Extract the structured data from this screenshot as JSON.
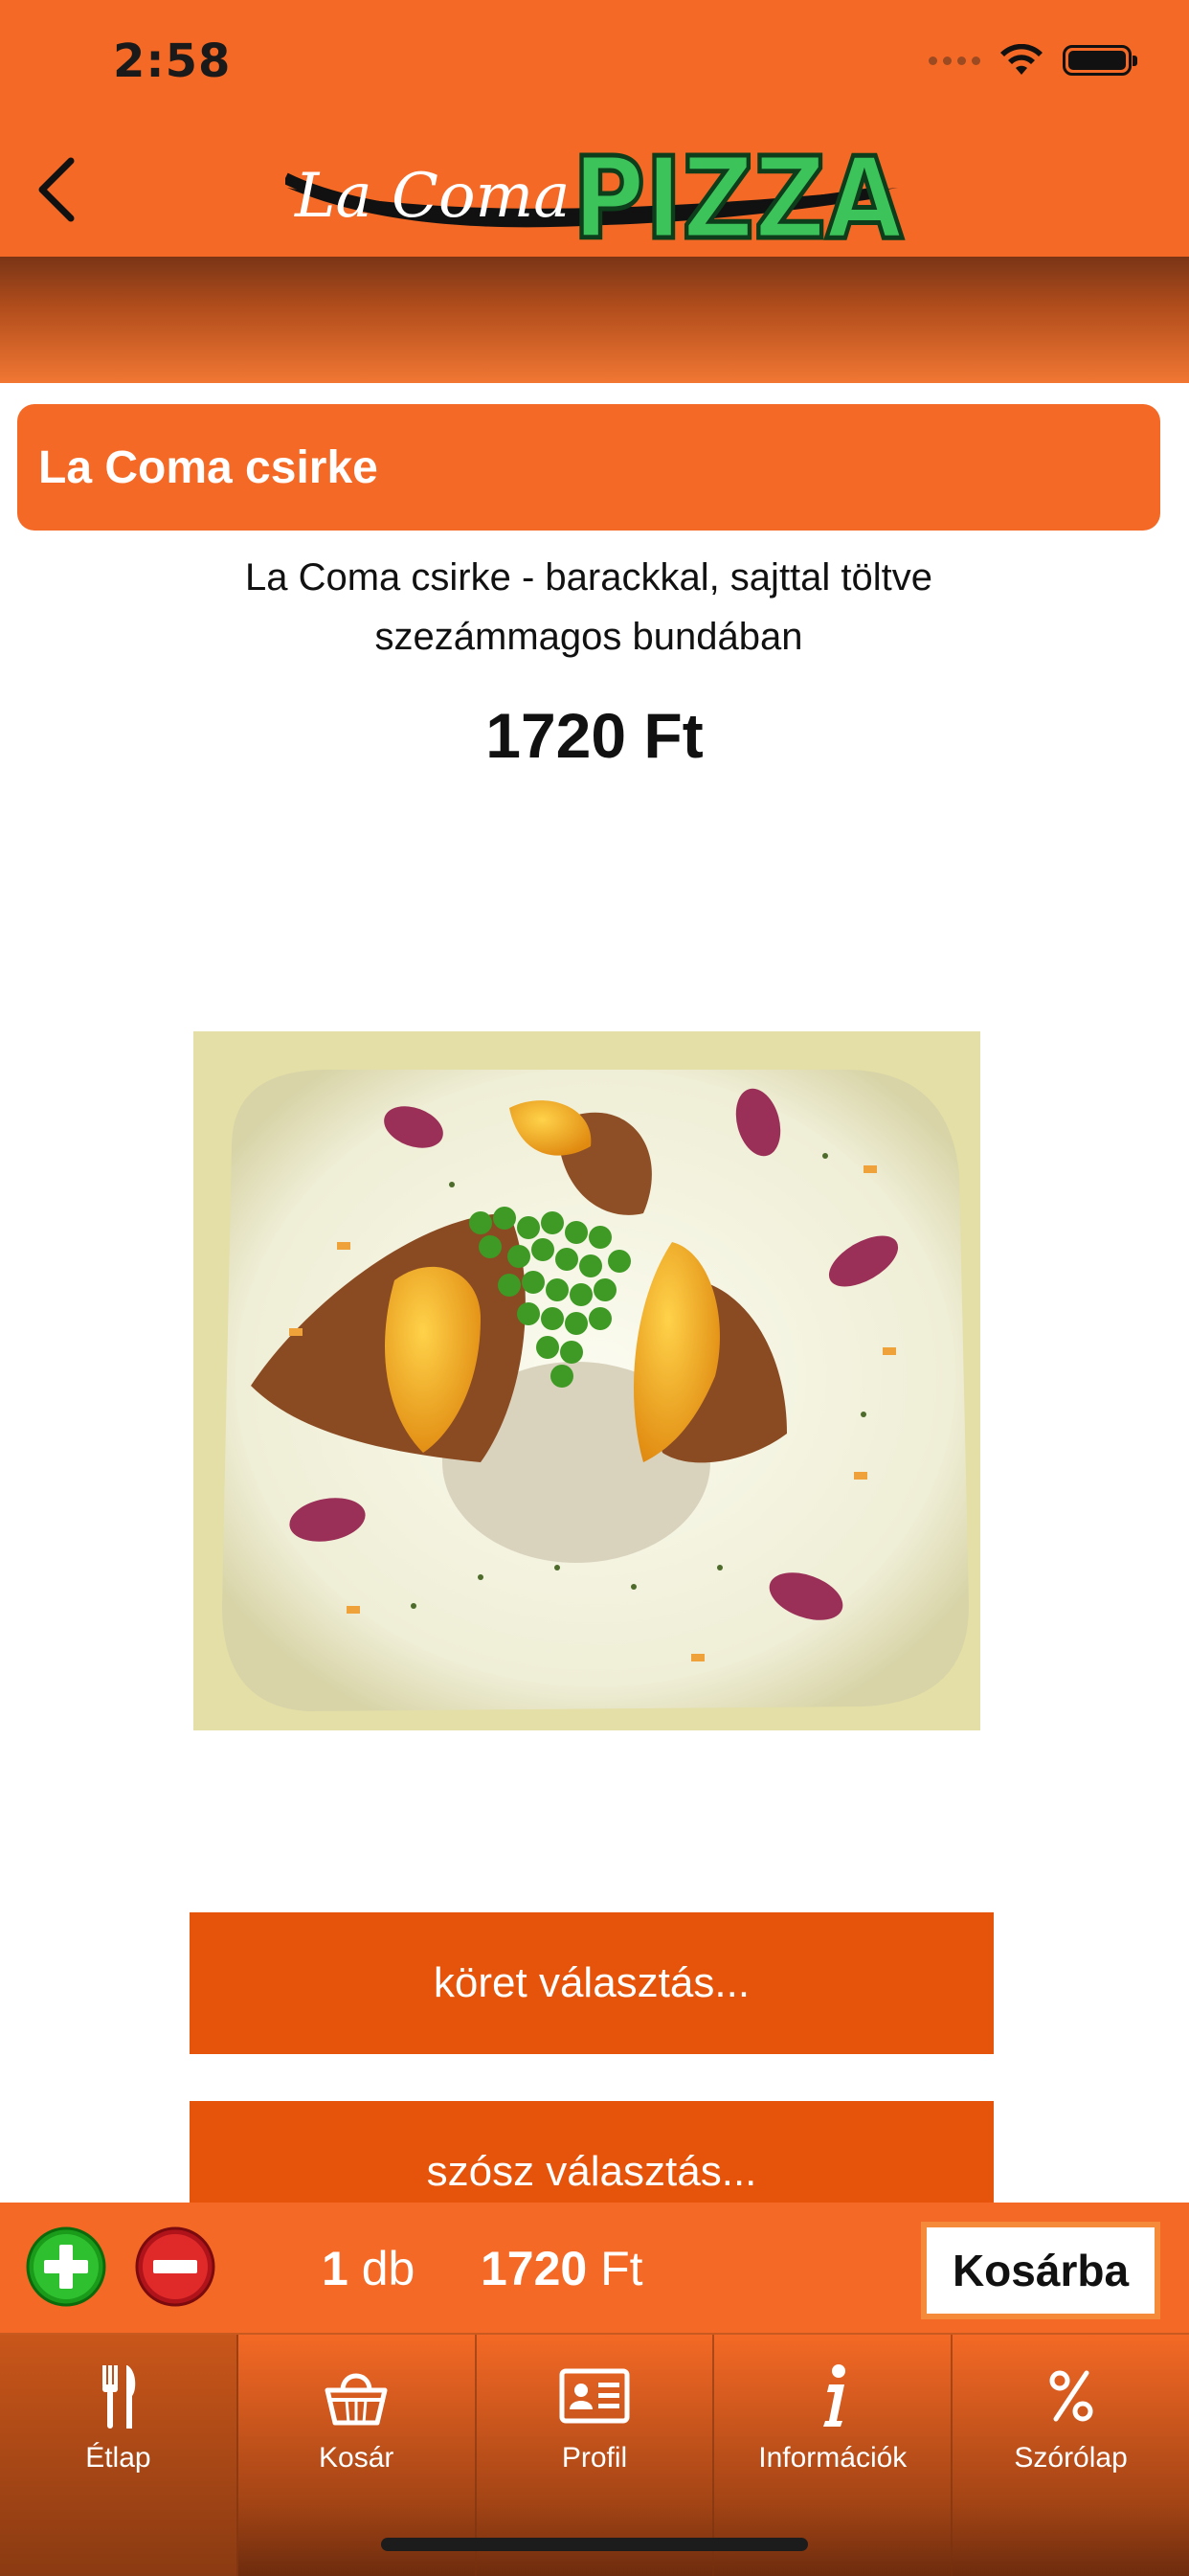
{
  "status_bar": {
    "time": "2:58"
  },
  "header": {
    "logo_script": "La Coma",
    "logo_word": "PIZZA"
  },
  "product": {
    "name": "La Coma csirke",
    "description": "La Coma csirke - barackkal, sajttal töltve szezámmagos bundában",
    "price": "1720 Ft"
  },
  "options": [
    {
      "label": "köret választás..."
    },
    {
      "label": "szósz választás..."
    }
  ],
  "order": {
    "quantity": "1",
    "quantity_unit": "db",
    "total": "1720",
    "currency": "Ft",
    "add_to_cart": "Kosárba"
  },
  "tabs": [
    {
      "label": "Étlap",
      "icon": "cutlery-icon",
      "active": true
    },
    {
      "label": "Kosár",
      "icon": "basket-icon",
      "active": false
    },
    {
      "label": "Profil",
      "icon": "profile-card-icon",
      "active": false
    },
    {
      "label": "Információk",
      "icon": "info-icon",
      "active": false
    },
    {
      "label": "Szórólap",
      "icon": "percent-icon",
      "active": false
    }
  ],
  "colors": {
    "brand_orange": "#f46925",
    "button_orange": "#e5540a",
    "logo_green": "#3cc45a"
  }
}
